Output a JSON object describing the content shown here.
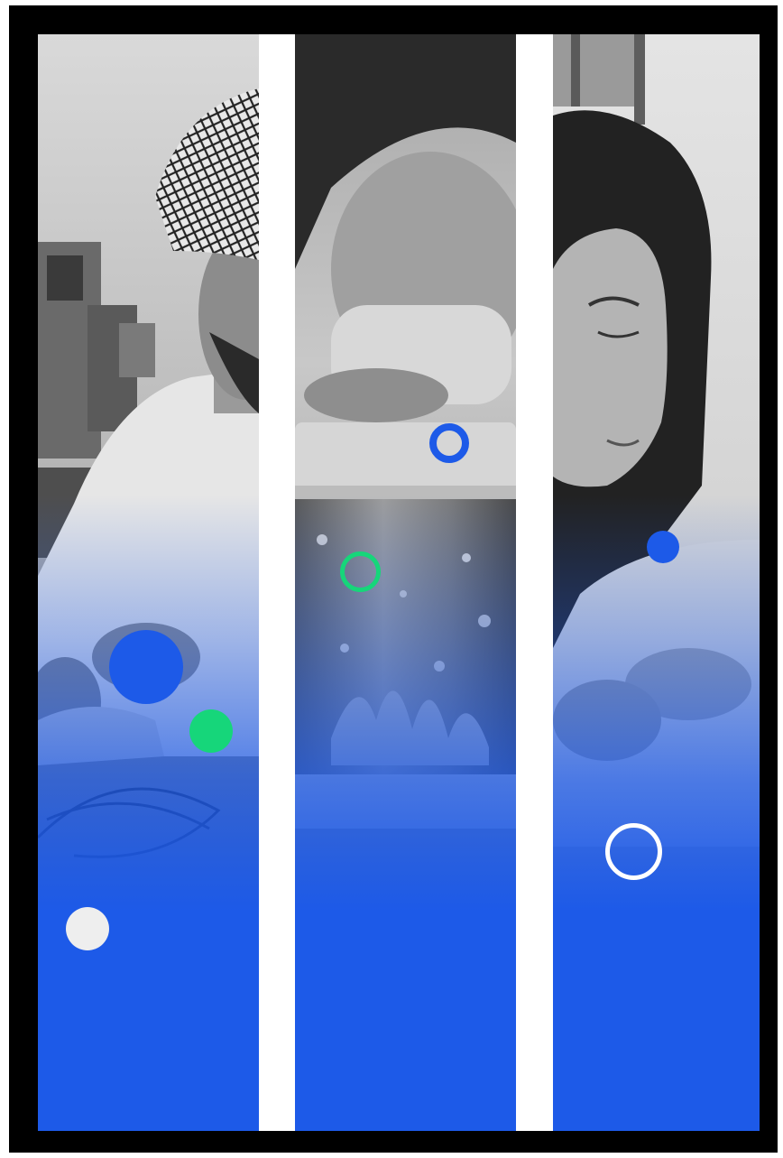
{
  "colors": {
    "frame": "#000000",
    "divider": "#ffffff",
    "accent_blue": "#1d5ae8",
    "accent_green": "#16d67a",
    "accent_light": "#eeeeee"
  },
  "panels": [
    {
      "subject": "man-in-lab"
    },
    {
      "subject": "container-with-plant-culture"
    },
    {
      "subject": "woman-in-lab"
    }
  ],
  "decorations": [
    {
      "name": "blue-filled-dot-large",
      "style": "filled",
      "color": "#1d5ae8"
    },
    {
      "name": "green-filled-dot",
      "style": "filled",
      "color": "#16d67a"
    },
    {
      "name": "light-filled-dot",
      "style": "filled",
      "color": "#eeeeee"
    },
    {
      "name": "blue-ring",
      "style": "ring",
      "color": "#1d5ae8"
    },
    {
      "name": "green-ring",
      "style": "ring",
      "color": "#16d67a"
    },
    {
      "name": "blue-filled-dot-small",
      "style": "filled",
      "color": "#1d5ae8"
    },
    {
      "name": "white-ring",
      "style": "ring",
      "color": "#ffffff"
    }
  ]
}
